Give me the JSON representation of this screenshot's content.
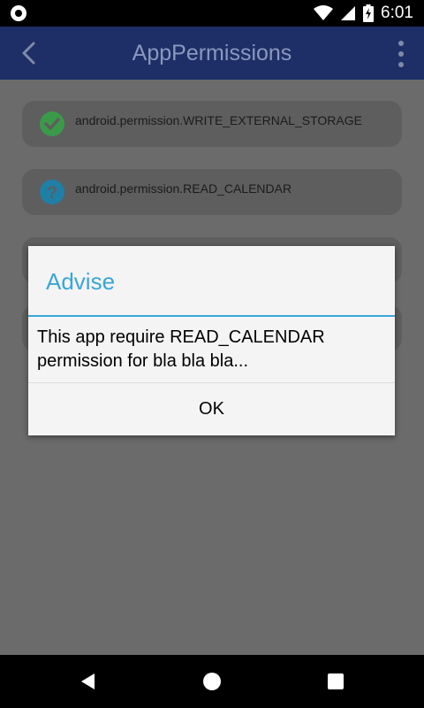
{
  "status_bar": {
    "time": "6:01"
  },
  "app_bar": {
    "title": "AppPermissions"
  },
  "permissions": [
    {
      "name": "android.permission.WRITE_EXTERNAL_STORAGE",
      "status": "granted",
      "icon": "check-circle-icon",
      "color": "#3a9a4a"
    },
    {
      "name": "android.permission.READ_CALENDAR",
      "status": "unknown",
      "icon": "question-circle-icon",
      "color": "#1f7fa6"
    }
  ],
  "dialog": {
    "title": "Advise",
    "message": "This app require READ_CALENDAR permission for bla bla bla...",
    "ok_label": "OK"
  },
  "colors": {
    "app_bar": "#1d2f66",
    "accent": "#39a6d8"
  }
}
